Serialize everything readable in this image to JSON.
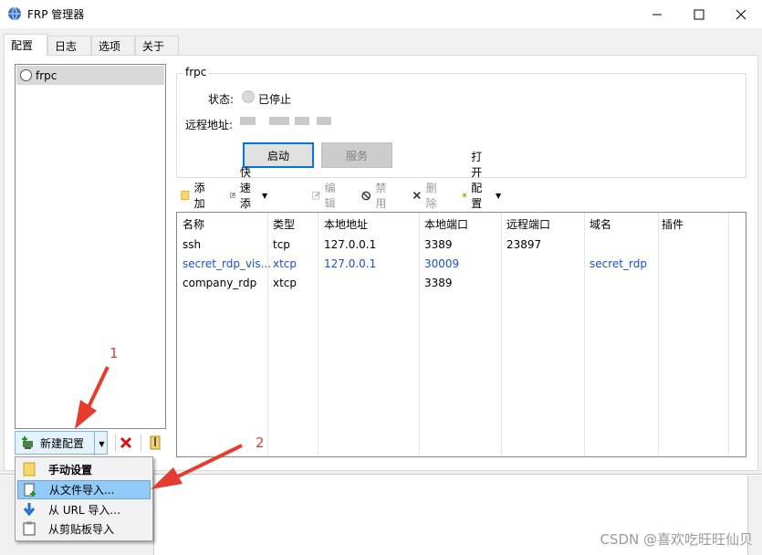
{
  "window": {
    "title": "FRP 管理器"
  },
  "tabs": [
    "配置",
    "日志",
    "选项",
    "关于"
  ],
  "config_list": {
    "items": [
      {
        "name": "frpc"
      }
    ]
  },
  "left_bar": {
    "new_config_label": "新建配置"
  },
  "group": {
    "title": "frpc",
    "status_label": "状态:",
    "status_value": "已停止",
    "remote_label": "远程地址:",
    "start_button": "启动",
    "service_button": "服务"
  },
  "toolbar": {
    "add": "添加",
    "quick_add": "快速添加",
    "edit": "编辑",
    "disable": "禁用",
    "delete": "删除",
    "open_config": "打开配置文件"
  },
  "table": {
    "columns": [
      "名称",
      "类型",
      "本地地址",
      "本地端口",
      "远程端口",
      "域名",
      "插件"
    ],
    "rows": [
      {
        "name": "ssh",
        "type": "tcp",
        "local_addr": "127.0.0.1",
        "local_port": "3389",
        "remote_port": "23897",
        "domain": "",
        "plugin": ""
      },
      {
        "name": "secret_rdp_vis...",
        "type": "xtcp",
        "local_addr": "127.0.0.1",
        "local_port": "30009",
        "remote_port": "",
        "domain": "secret_rdp",
        "plugin": ""
      },
      {
        "name": "company_rdp",
        "type": "xtcp",
        "local_addr": "",
        "local_port": "3389",
        "remote_port": "",
        "domain": "",
        "plugin": ""
      }
    ],
    "highlight_color": "#1a4fd6"
  },
  "dropdown_menu": {
    "items": [
      "手动设置",
      "从文件导入...",
      "从 URL 导入...",
      "从剪贴板导入"
    ],
    "highlighted": "从文件导入..."
  },
  "annotations": {
    "label_1": "1",
    "label_2": "2",
    "color": "#e53c2f"
  },
  "watermark": "CSDN @喜欢吃旺旺仙贝"
}
